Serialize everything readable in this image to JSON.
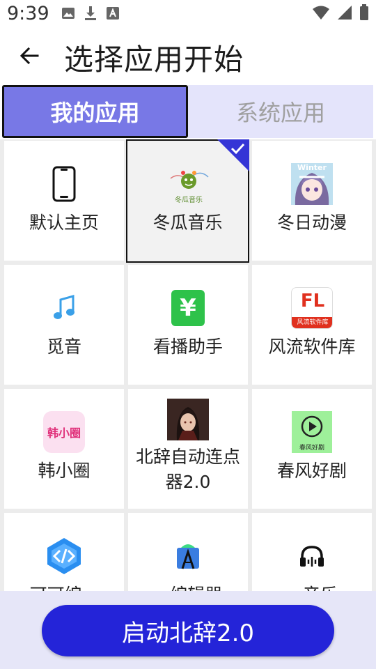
{
  "status_bar": {
    "time": "9:39",
    "left_icons": [
      "image-icon",
      "download-icon",
      "font-icon"
    ],
    "right_icons": [
      "wifi-icon",
      "signal-icon",
      "battery-icon"
    ]
  },
  "header": {
    "title": "选择应用开始",
    "back_icon": "arrow-left-icon"
  },
  "tabs": [
    {
      "label": "我的应用",
      "active": true
    },
    {
      "label": "系统应用",
      "active": false
    }
  ],
  "apps": [
    {
      "label": "默认主页",
      "icon": "phone-icon",
      "selected": false
    },
    {
      "label": "冬瓜音乐",
      "icon": "dongua-music-icon",
      "icon_text": "冬瓜音乐",
      "selected": true
    },
    {
      "label": "冬日动漫",
      "icon": "anime-girl-icon",
      "icon_text": "Winter",
      "selected": false
    },
    {
      "label": "觅音",
      "icon": "music-note-icon",
      "selected": false
    },
    {
      "label": "看播助手",
      "icon": "yen-icon",
      "icon_text": "¥",
      "selected": false
    },
    {
      "label": "风流软件库",
      "icon": "fl-library-icon",
      "icon_text": "FL",
      "icon_subtext": "风流软件库",
      "selected": false
    },
    {
      "label": "韩小圈",
      "icon": "hanxiaoquan-icon",
      "icon_text": "韩小圈",
      "selected": false
    },
    {
      "label": "北辞自动连点器2.0",
      "icon": "anime-avatar-icon",
      "selected": false
    },
    {
      "label": "春风好剧",
      "icon": "play-circle-icon",
      "icon_text": "春风好剧",
      "selected": false
    },
    {
      "label": "可可编...",
      "icon": "code-icon",
      "selected": false
    },
    {
      "label": "...编辑器",
      "icon": "android-studio-icon",
      "selected": false
    },
    {
      "label": "...音乐",
      "icon": "headphones-icon",
      "selected": false
    }
  ],
  "footer": {
    "launch_label": "启动北辞2.0"
  },
  "colors": {
    "active_tab": "#7878e6",
    "inactive_tab_bg": "#e4e4fb",
    "button": "#2424d8",
    "check_corner": "#3535d6",
    "bottom_bg": "#e6e6f8"
  }
}
